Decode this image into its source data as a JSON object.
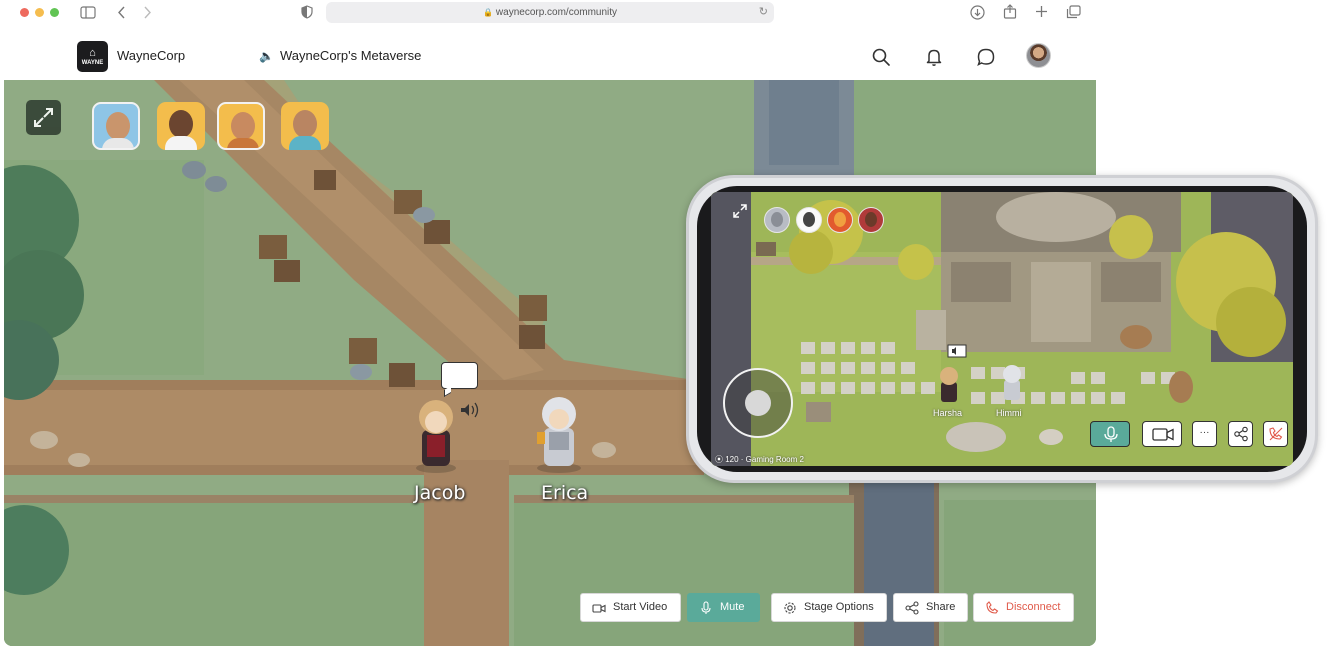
{
  "browser": {
    "url": "waynecorp.com/community"
  },
  "header": {
    "brand": "WayneCorp",
    "logo_text": "WAYNE",
    "room_title": "WayneCorp's Metaverse",
    "icons": [
      "search-icon",
      "bell-icon",
      "chat-icon"
    ]
  },
  "game": {
    "participants": [
      "participant-1",
      "participant-2",
      "participant-3",
      "participant-4"
    ],
    "characters": [
      {
        "name": "Jacob"
      },
      {
        "name": "Erica"
      }
    ]
  },
  "controls": {
    "start_video": "Start Video",
    "mute": "Mute",
    "stage_options": "Stage Options",
    "share": "Share",
    "disconnect": "Disconnect"
  },
  "mobile": {
    "characters": [
      {
        "name": "Harsha"
      },
      {
        "name": "Himmi"
      }
    ],
    "room_label": "⦿ 120 · Gaming Room 2",
    "more_label": "···"
  },
  "colors": {
    "accent": "#5aaa9a",
    "danger": "#e05a4a"
  }
}
